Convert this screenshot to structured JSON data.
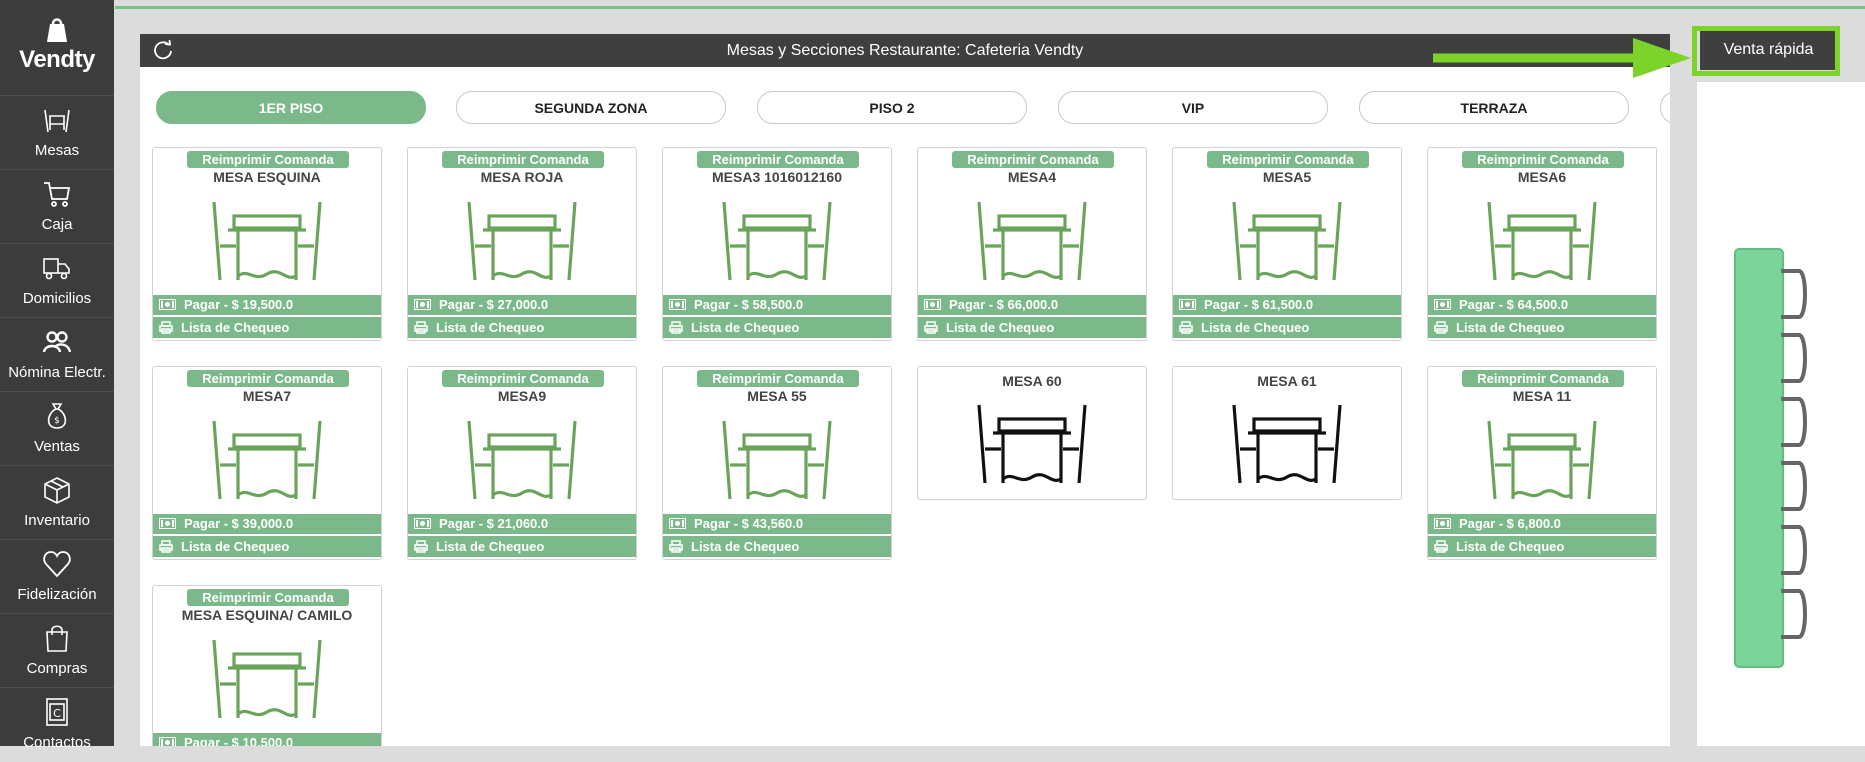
{
  "app": {
    "brand": "Vendty"
  },
  "sidebar": {
    "items": [
      {
        "label": "Mesas",
        "icon": "dining-table-icon"
      },
      {
        "label": "Caja",
        "icon": "cart-icon"
      },
      {
        "label": "Domicilios",
        "icon": "delivery-truck-icon"
      },
      {
        "label": "Nómina Electr.",
        "icon": "people-icon"
      },
      {
        "label": "Ventas",
        "icon": "money-bag-icon"
      },
      {
        "label": "Inventario",
        "icon": "box-icon"
      },
      {
        "label": "Fidelización",
        "icon": "heart-icon"
      },
      {
        "label": "Compras",
        "icon": "shopping-bag-icon"
      },
      {
        "label": "Contactos",
        "icon": "contacts-book-icon"
      }
    ]
  },
  "panel": {
    "title": "Mesas y Secciones Restaurante: Cafeteria Vendty",
    "tabs": [
      {
        "label": "1ER PISO",
        "active": true
      },
      {
        "label": "SEGUNDA ZONA",
        "active": false
      },
      {
        "label": "PISO 2",
        "active": false
      },
      {
        "label": "VIP",
        "active": false
      },
      {
        "label": "TERRAZA",
        "active": false
      }
    ]
  },
  "labels": {
    "reprint": "Reimprimir Comanda",
    "checklist": "Lista de Chequeo"
  },
  "tables": [
    {
      "name": "MESA ESQUINA",
      "occupied": true,
      "pay": "Pagar - $ 19,500.0"
    },
    {
      "name": "MESA ROJA",
      "occupied": true,
      "pay": "Pagar - $ 27,000.0"
    },
    {
      "name": "MESA3 1016012160",
      "occupied": true,
      "pay": "Pagar - $ 58,500.0"
    },
    {
      "name": "MESA4",
      "occupied": true,
      "pay": "Pagar - $ 66,000.0"
    },
    {
      "name": "MESA5",
      "occupied": true,
      "pay": "Pagar - $ 61,500.0"
    },
    {
      "name": "MESA6",
      "occupied": true,
      "pay": "Pagar - $ 64,500.0"
    },
    {
      "name": "MESA7",
      "occupied": true,
      "pay": "Pagar - $ 39,000.0"
    },
    {
      "name": "MESA9",
      "occupied": true,
      "pay": "Pagar - $ 21,060.0"
    },
    {
      "name": "MESA 55",
      "occupied": true,
      "pay": "Pagar - $ 43,560.0"
    },
    {
      "name": "MESA 60",
      "occupied": false,
      "pay": ""
    },
    {
      "name": "MESA 61",
      "occupied": false,
      "pay": ""
    },
    {
      "name": "MESA 11",
      "occupied": true,
      "pay": "Pagar - $ 6,800.0"
    },
    {
      "name": "MESA ESQUINA/ CAMILO",
      "occupied": true,
      "pay": "Pagar - $ 10,500.0"
    }
  ],
  "quick_sale": {
    "label": "Venta rápida"
  },
  "colors": {
    "green": "#7bb98a",
    "highlight": "#7cd42a",
    "dark": "#3f3f3f"
  }
}
